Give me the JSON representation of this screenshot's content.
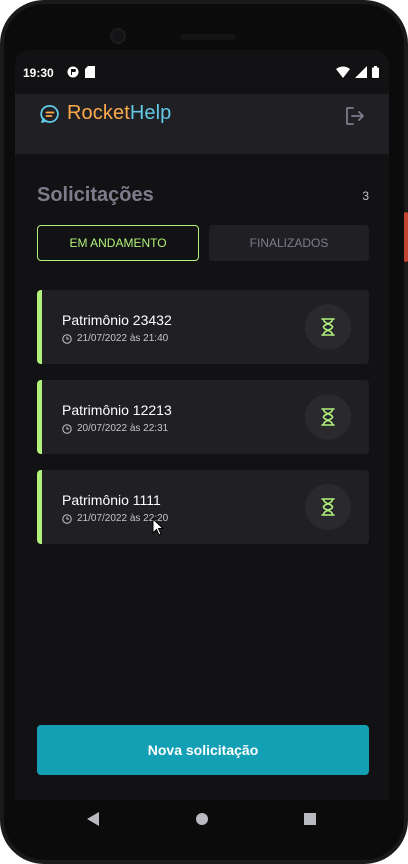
{
  "status_bar": {
    "time": "19:30"
  },
  "header": {
    "brand_first": "Rocket",
    "brand_second": "Help"
  },
  "main": {
    "title": "Solicitações",
    "count": "3",
    "tabs": [
      {
        "label": "EM ANDAMENTO",
        "active": true
      },
      {
        "label": "FINALIZADOS",
        "active": false
      }
    ],
    "orders": [
      {
        "title": "Patrimônio 23432",
        "date": "21/07/2022 às 21:40",
        "status_icon": "hourglass-icon"
      },
      {
        "title": "Patrimônio 12213",
        "date": "20/07/2022 às 22:31",
        "status_icon": "hourglass-icon"
      },
      {
        "title": "Patrimônio 1111",
        "date": "21/07/2022 às 22:20",
        "status_icon": "hourglass-icon"
      }
    ],
    "new_request_label": "Nova solicitação"
  },
  "colors": {
    "accent_green": "#b2f17a",
    "brand_orange": "#fba94c",
    "brand_blue": "#61c9e4",
    "button_teal": "#14a0b4",
    "background": "#121214",
    "surface": "#202024"
  }
}
